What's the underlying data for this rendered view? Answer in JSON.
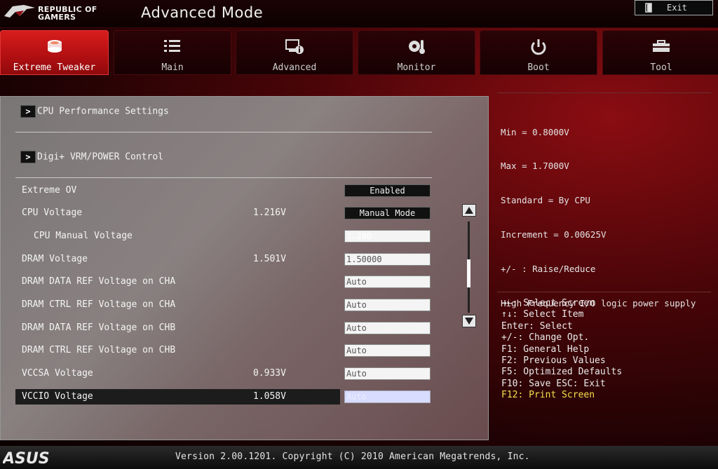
{
  "brand": {
    "line1": "REPUBLIC OF",
    "line2": "GAMERS"
  },
  "header": {
    "title": "Advanced Mode",
    "exit_label": "Exit"
  },
  "tabs": [
    {
      "label": "Extreme Tweaker",
      "icon": "cpu-chip-icon",
      "active": true
    },
    {
      "label": "Main",
      "icon": "list-icon",
      "active": false
    },
    {
      "label": "Advanced",
      "icon": "info-monitor-icon",
      "active": false
    },
    {
      "label": "Monitor",
      "icon": "thermometer-fan-icon",
      "active": false
    },
    {
      "label": "Boot",
      "icon": "power-icon",
      "active": false
    },
    {
      "label": "Tool",
      "icon": "toolbox-icon",
      "active": false
    }
  ],
  "submenus": [
    {
      "arrow": ">",
      "label": "CPU Performance Settings"
    },
    {
      "arrow": ">",
      "label": "Digi+ VRM/POWER Control"
    }
  ],
  "settings": [
    {
      "name": "Extreme OV",
      "current": "",
      "value": "Enabled",
      "style": "dark"
    },
    {
      "name": "CPU Voltage",
      "current": "1.216V",
      "value": "Manual Mode",
      "style": "dark"
    },
    {
      "name": "  CPU Manual Voltage",
      "current": "",
      "value": "1.200",
      "style": "blank"
    },
    {
      "name": "DRAM Voltage",
      "current": "1.501V",
      "value": "1.50000",
      "style": "light"
    },
    {
      "name": "DRAM DATA REF Voltage on CHA",
      "current": "",
      "value": "Auto",
      "style": "light"
    },
    {
      "name": "DRAM CTRL REF Voltage on CHA",
      "current": "",
      "value": "Auto",
      "style": "light"
    },
    {
      "name": "DRAM DATA REF Voltage on CHB",
      "current": "",
      "value": "Auto",
      "style": "light"
    },
    {
      "name": "DRAM CTRL REF Voltage on CHB",
      "current": "",
      "value": "Auto",
      "style": "light"
    },
    {
      "name": "VCCSA Voltage",
      "current": "0.933V",
      "value": "Auto",
      "style": "light"
    },
    {
      "name": "VCCIO Voltage",
      "current": "1.058V",
      "value": "Auto",
      "style": "selected"
    }
  ],
  "help_text": [
    "Min = 0.8000V",
    "Max = 1.7000V",
    "Standard = By CPU",
    "Increment = 0.00625V",
    "+/- : Raise/Reduce",
    "High Frequency I/O logic power supply"
  ],
  "keys": [
    "→←: Select Screen",
    "↑↓: Select Item",
    "Enter: Select",
    "+/-: Change Opt.",
    "F1: General Help",
    "F2: Previous Values",
    "F5: Optimized Defaults",
    "F10: Save  ESC: Exit",
    "F12: Print Screen"
  ],
  "footer": {
    "brand": "ASUS",
    "version": "Version 2.00.1201. Copyright (C) 2010 American Megatrends, Inc."
  },
  "colors": {
    "accent": "#d81d1d",
    "highlight": "#f4e04d"
  }
}
